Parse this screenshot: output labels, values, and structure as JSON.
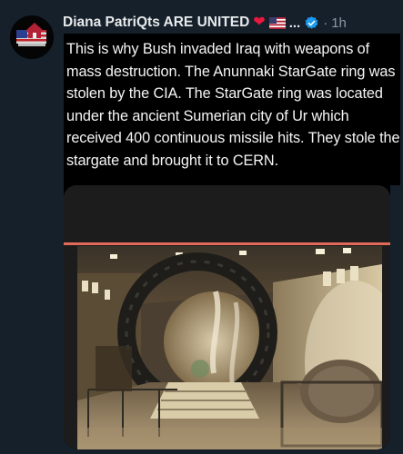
{
  "author": {
    "display_name": "Diana PatriQts ARE UNITED",
    "truncation": "...",
    "separator": "·",
    "time": "1h",
    "emoji": [
      "heart-icon",
      "us-flag-icon"
    ],
    "verified_badge_color": "#1d9bf0"
  },
  "tweet": {
    "text": "This is why Bush invaded Iraq with weapons of mass destruction.  The Anunnaki StarGate ring was stolen by the CIA. The StarGate ring was located under the ancient Sumerian city of Ur which received 400 continuous missile hits. They stole the stargate and brought it to CERN."
  },
  "media": {
    "scene": "stargate-ring-in-industrial-hall",
    "accent_line_color": "#e2695a"
  },
  "theme": {
    "background": "#15202b",
    "text_primary": "#e7e9ea",
    "text_secondary": "#8b98a5",
    "heart_color": "#e8193c"
  }
}
